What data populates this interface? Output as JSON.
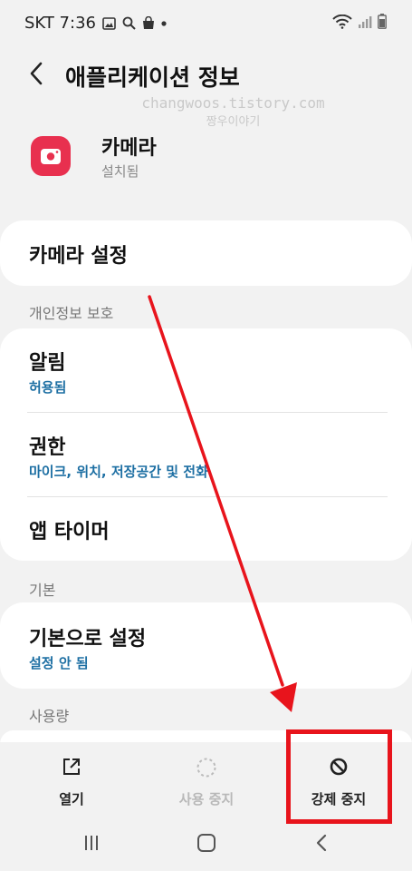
{
  "status_bar": {
    "carrier_time": "SKT 7:36"
  },
  "header": {
    "title": "애플리케이션 정보"
  },
  "watermark": {
    "line1": "changwoos.tistory.com",
    "line2": "짱우이야기"
  },
  "app": {
    "name": "카메라",
    "status": "설치됨",
    "icon_color": "#e8304f"
  },
  "camera_settings": {
    "label": "카메라 설정"
  },
  "privacy": {
    "section_title": "개인정보 보호",
    "items": [
      {
        "label": "알림",
        "sub": "허용됨"
      },
      {
        "label": "권한",
        "sub": "마이크, 위치, 저장공간 및 전화"
      },
      {
        "label": "앱 타이머",
        "sub": ""
      }
    ]
  },
  "defaults": {
    "section_title": "기본",
    "item_label": "기본으로 설정",
    "item_sub": "설정 안 됨"
  },
  "usage": {
    "section_title": "사용량"
  },
  "bottom_actions": {
    "open": "열기",
    "disable": "사용 중지",
    "force_stop": "강제 중지"
  },
  "colors": {
    "accent_text": "#1d6fa3",
    "highlight_red": "#e8141c",
    "background": "#f2f2f2"
  }
}
